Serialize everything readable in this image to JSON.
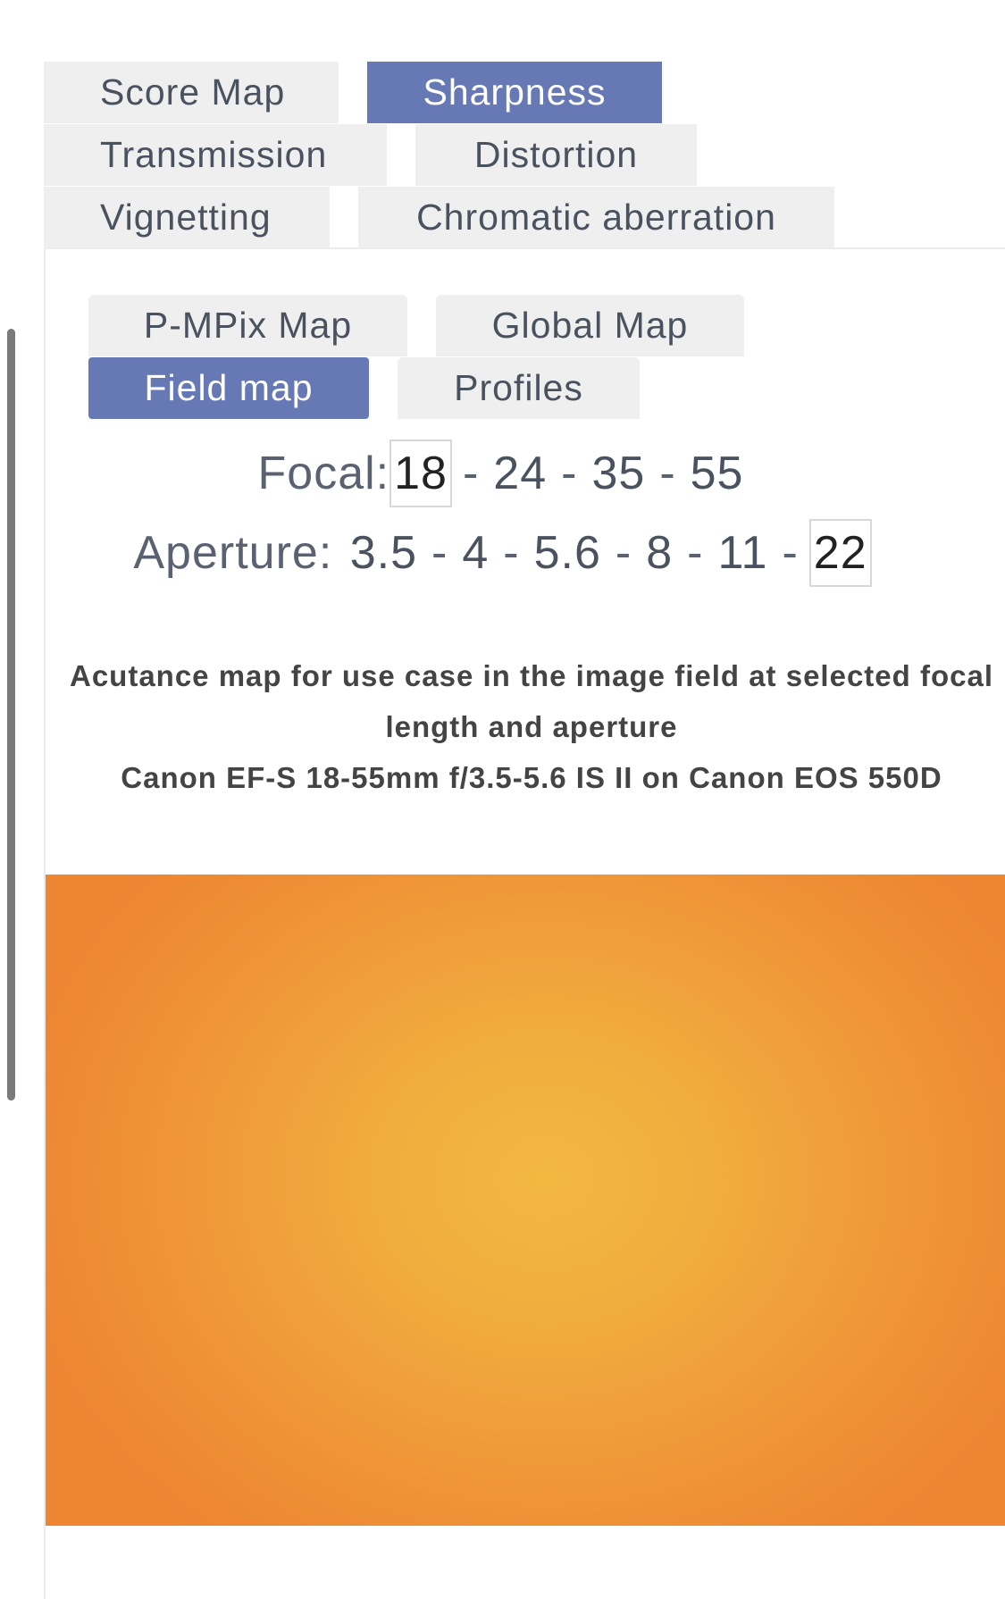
{
  "main_tabs": [
    {
      "label": "Score Map",
      "active": false
    },
    {
      "label": "Sharpness",
      "active": true
    },
    {
      "label": "Transmission",
      "active": false
    },
    {
      "label": "Distortion",
      "active": false
    },
    {
      "label": "Vignetting",
      "active": false
    },
    {
      "label": "Chromatic aberration",
      "active": false
    }
  ],
  "sub_tabs": [
    {
      "label": "P-MPix Map",
      "active": false
    },
    {
      "label": "Global Map",
      "active": false
    },
    {
      "label": "Field map",
      "active": true
    },
    {
      "label": "Profiles",
      "active": false
    }
  ],
  "focal": {
    "label": "Focal:",
    "options": [
      "18",
      "24",
      "35",
      "55"
    ],
    "selected": "18"
  },
  "aperture": {
    "label": "Aperture:",
    "options": [
      "3.5",
      "4",
      "5.6",
      "8",
      "11",
      "22"
    ],
    "selected": "22"
  },
  "separator": "-",
  "caption": {
    "line1": "Acutance map for use case in the image field at selected focal length and aperture",
    "line2": "Canon EF-S 18-55mm f/3.5-5.6 IS II on Canon EOS 550D"
  },
  "colors": {
    "active_tab": "#6679b4",
    "inactive_tab": "#efefef",
    "map_center": "#f2b840",
    "map_edge": "#ed8531"
  }
}
